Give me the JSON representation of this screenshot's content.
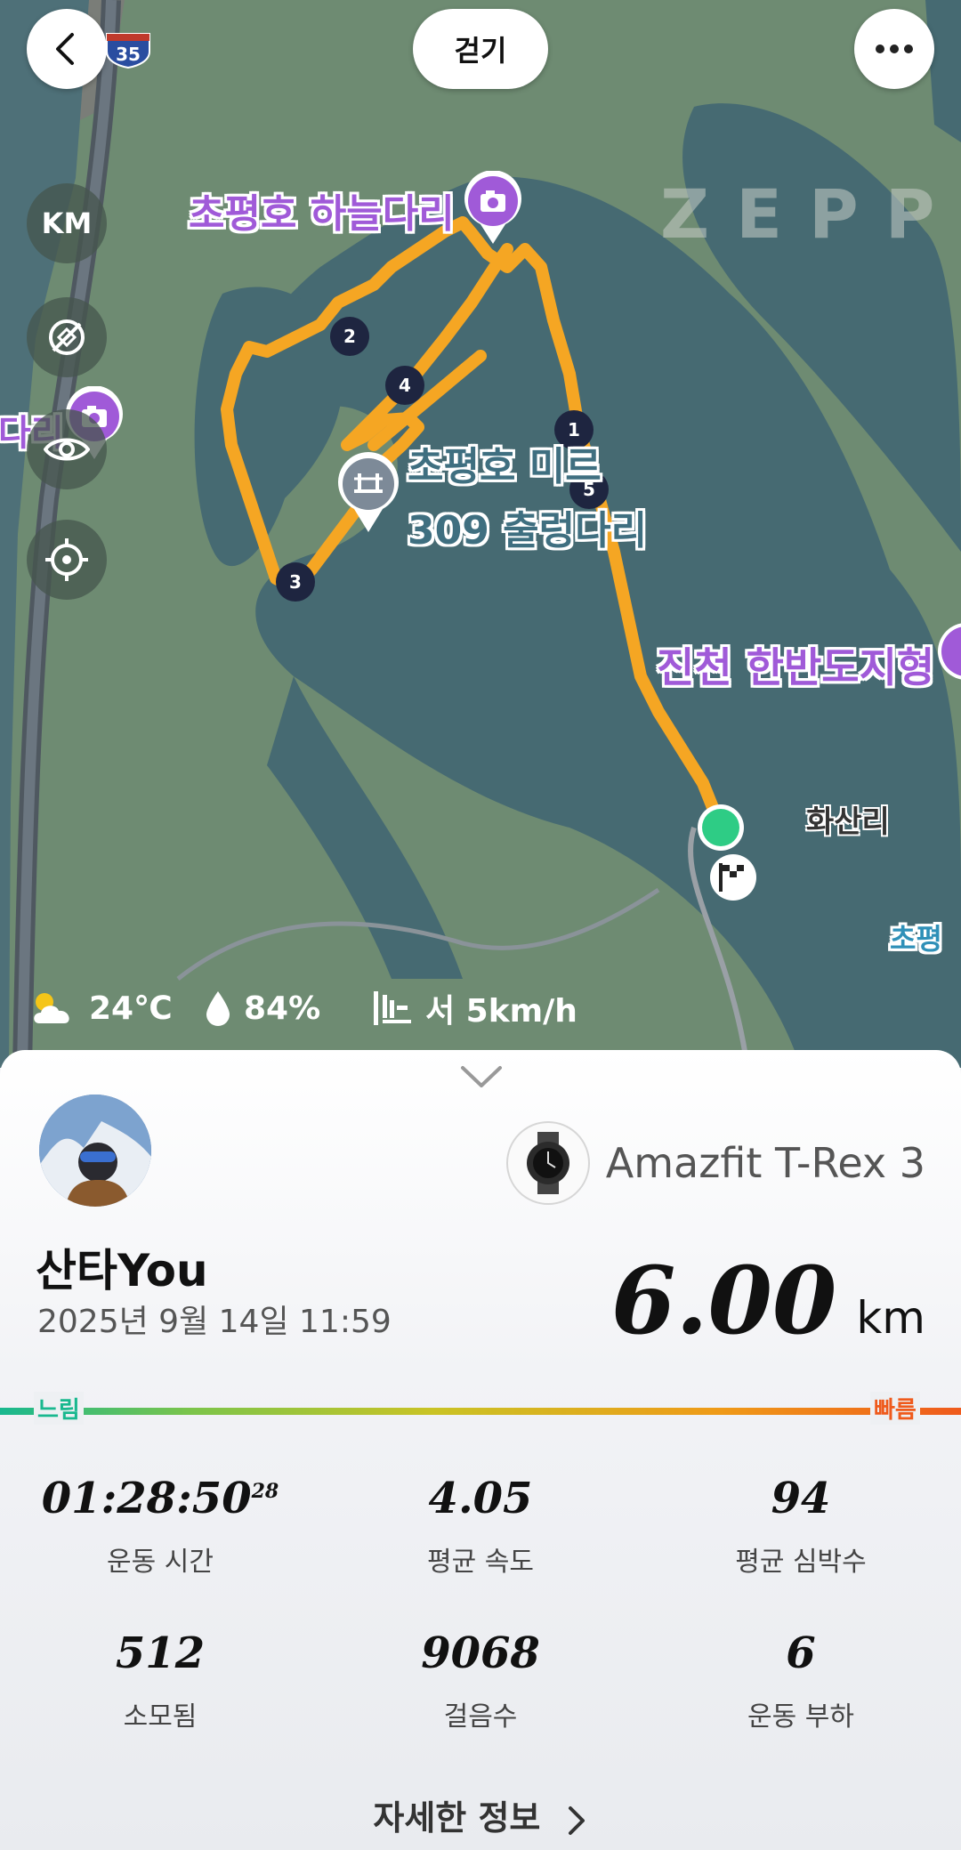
{
  "header": {
    "activity_type": "걷기",
    "highway_marker": "35"
  },
  "map": {
    "watermark": "ZEPP",
    "unit_button": "KM",
    "pois": [
      {
        "name": "초평호 하늘다리"
      },
      {
        "name": "초평호 미르 309 출렁다리",
        "line1": "초평호 미르",
        "line2": "309 출렁다리"
      },
      {
        "name": "진천 한반도지형"
      },
      {
        "name": "다리"
      }
    ],
    "village": "화산리",
    "edge_label": "초평",
    "km_markers": [
      "1",
      "2",
      "3",
      "4",
      "5"
    ]
  },
  "weather": {
    "temperature": "24℃",
    "humidity": "84%",
    "wind": "서 5km/h"
  },
  "summary": {
    "device_name": "Amazfit T-Rex 3",
    "user_name": "산타You",
    "date_time": "2025년 9월 14일 11:59",
    "distance": "6.00",
    "distance_unit": "km"
  },
  "speed_scale": {
    "slow": "느림",
    "fast": "빠름"
  },
  "stats": [
    {
      "value": "01:28:50",
      "sup": "28",
      "label": "운동 시간"
    },
    {
      "value": "4.05",
      "label": "평균 속도"
    },
    {
      "value": "94",
      "label": "평균 심박수"
    },
    {
      "value": "512",
      "label": "소모됨"
    },
    {
      "value": "9068",
      "label": "걸음수"
    },
    {
      "value": "6",
      "label": "운동 부하"
    }
  ],
  "footer": {
    "detail_label": "자세한 정보"
  },
  "colors": {
    "route": "#f5a623",
    "start": "#2ecc85",
    "poi": "#a05ad8",
    "map_land": "#6e8b72",
    "map_water": "#466a72"
  }
}
